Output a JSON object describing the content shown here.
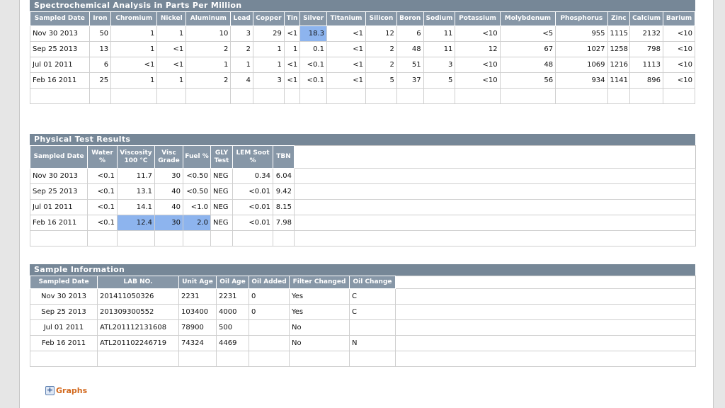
{
  "spectro": {
    "title": "Spectrochemical Analysis in Parts Per Million",
    "headers": [
      "Sampled Date",
      "Iron",
      "Chromium",
      "Nickel",
      "Aluminum",
      "Lead",
      "Copper",
      "Tin",
      "Silver",
      "Titanium",
      "Silicon",
      "Boron",
      "Sodium",
      "Potassium",
      "Molybdenum",
      "Phosphorus",
      "Zinc",
      "Calcium",
      "Barium"
    ],
    "rows": [
      [
        "Nov 30 2013",
        "50",
        "1",
        "1",
        "10",
        "3",
        "29",
        "<1",
        "18.3",
        "<1",
        "12",
        "6",
        "11",
        "<10",
        "<5",
        "955",
        "1115",
        "2132",
        "<10"
      ],
      [
        "Sep 25 2013",
        "13",
        "1",
        "<1",
        "2",
        "2",
        "1",
        "1",
        "0.1",
        "<1",
        "2",
        "48",
        "11",
        "12",
        "67",
        "1027",
        "1258",
        "798",
        "<10"
      ],
      [
        "Jul 01 2011",
        "6",
        "<1",
        "<1",
        "1",
        "1",
        "1",
        "<1",
        "<0.1",
        "<1",
        "2",
        "51",
        "3",
        "<10",
        "48",
        "1069",
        "1216",
        "1113",
        "<10"
      ],
      [
        "Feb 16 2011",
        "25",
        "1",
        "1",
        "2",
        "4",
        "3",
        "<1",
        "<0.1",
        "<1",
        "5",
        "37",
        "5",
        "<10",
        "56",
        "934",
        "1141",
        "896",
        "<10"
      ]
    ]
  },
  "physical": {
    "title": "Physical Test Results",
    "headers": [
      "Sampled Date",
      "Water %",
      "Viscosity 100 °C",
      "Visc Grade",
      "Fuel %",
      "GLY Test",
      "LEM Soot %",
      "TBN"
    ],
    "rows": [
      [
        "Nov 30 2013",
        "<0.1",
        "11.7",
        "30",
        "<0.50",
        "NEG",
        "0.34",
        "6.04"
      ],
      [
        "Sep 25 2013",
        "<0.1",
        "13.1",
        "40",
        "<0.50",
        "NEG",
        "<0.01",
        "9.42"
      ],
      [
        "Jul 01 2011",
        "<0.1",
        "14.1",
        "40",
        "<1.0",
        "NEG",
        "<0.01",
        "8.15"
      ],
      [
        "Feb 16 2011",
        "<0.1",
        "12.4",
        "30",
        "2.0",
        "NEG",
        "<0.01",
        "7.98"
      ]
    ]
  },
  "sample": {
    "title": "Sample Information",
    "headers": [
      "Sampled Date",
      "LAB NO.",
      "Unit Age",
      "Oil Age",
      "Oil Added",
      "Filter Changed",
      "Oil Change"
    ],
    "rows": [
      [
        "Nov 30 2013",
        "201411050326",
        "2231",
        "2231",
        "0",
        "Yes",
        "C"
      ],
      [
        "Sep 25 2013",
        "201309300552",
        "103400",
        "4000",
        "0",
        "Yes",
        "C"
      ],
      [
        "Jul 01 2011",
        "ATL201112131608",
        "78900",
        "500",
        "",
        "No",
        ""
      ],
      [
        "Feb 16 2011",
        "ATL201102246719",
        "74324",
        "4469",
        "",
        "No",
        "N"
      ]
    ]
  },
  "graphs_link": {
    "icon": "plus-icon",
    "label": "Graphs"
  },
  "colors": {
    "header_bar": "#768797",
    "column_header": "#8797a7",
    "highlight": "#8db4ee",
    "link": "#d2691e"
  }
}
